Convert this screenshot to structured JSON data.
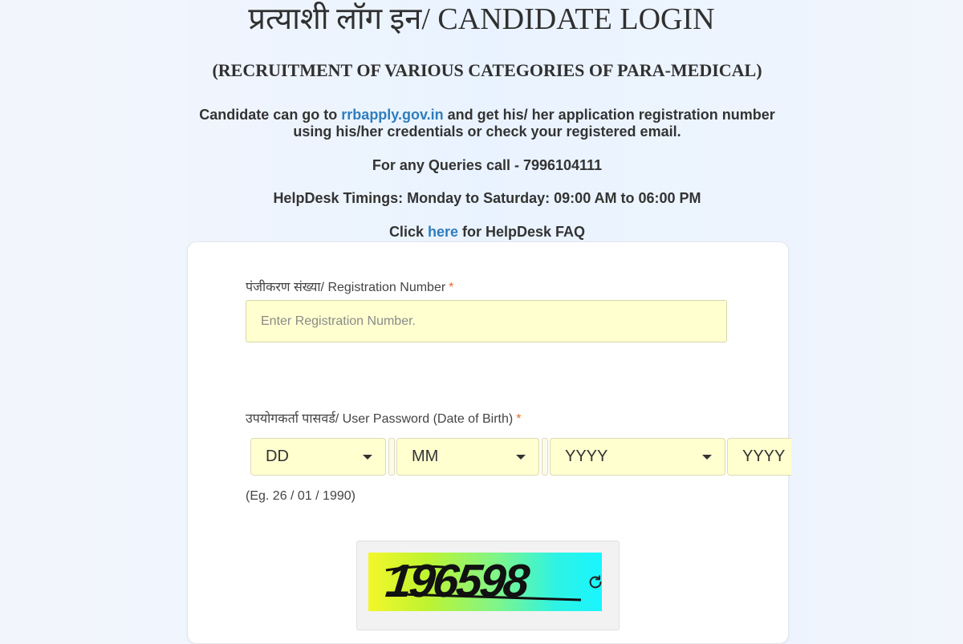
{
  "header": {
    "title": "प्रत्याशी लॉग इन/ CANDIDATE LOGIN",
    "subtitle": "(RECRUITMENT OF VARIOUS CATEGORIES OF PARA-MEDICAL)"
  },
  "info": {
    "line1_prefix": "Candidate can go to ",
    "line1_link": "rrbapply.gov.in",
    "line1_suffix": " and get his/ her application registration number",
    "line2": "using his/her credentials or check your registered email.",
    "queries": "For any Queries call - 7996104111",
    "timings": "HelpDesk Timings: Monday to Saturday: 09:00 AM to 06:00 PM",
    "faq_prefix": "Click ",
    "faq_link": "here",
    "faq_suffix": " for HelpDesk FAQ"
  },
  "form": {
    "registration": {
      "label": "पंजीकरण संख्या/ Registration Number",
      "required_mark": "*",
      "placeholder": "Enter Registration Number.",
      "value": ""
    },
    "password": {
      "label": "उपयोगकर्ता पासवर्ड/ User Password (Date of Birth)",
      "required_mark": "*",
      "day": "DD",
      "month": "MM",
      "year": "YYYY",
      "year2": "YYYY",
      "example": "(Eg. 26 / 01 / 1990)"
    },
    "captcha": {
      "text": "196598",
      "refresh_icon": "refresh-icon"
    }
  },
  "colors": {
    "link": "#2f7dbe",
    "input_bg": "#ffffd0",
    "required": "#e86a2a",
    "text": "#333333"
  }
}
